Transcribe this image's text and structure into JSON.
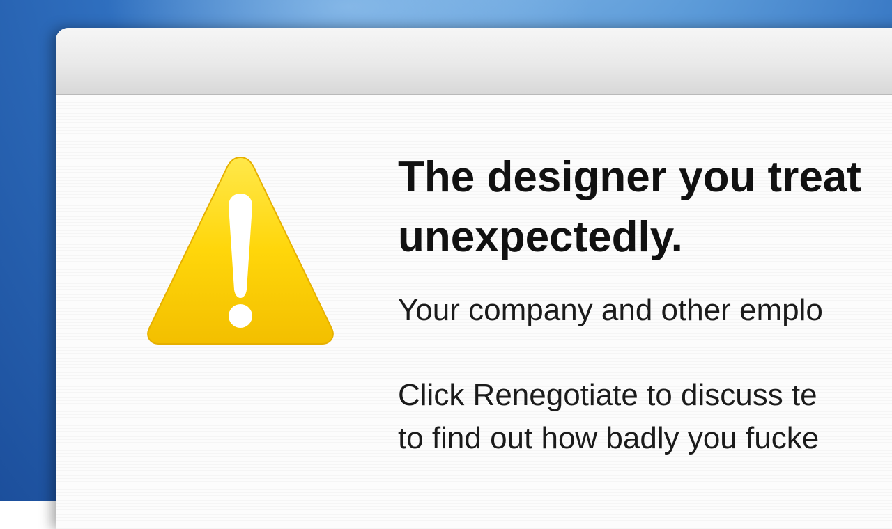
{
  "dialog": {
    "title_lines": "The designer you treat\nunexpectedly.",
    "message": "Your company and other emplo",
    "instruction_lines": "Click Renegotiate to discuss te\nto find out how badly you fucke"
  },
  "icons": {
    "warning": "warning-triangle-icon"
  },
  "colors": {
    "desktop_blue": "#2f6fbf",
    "warning_yellow": "#ffd400",
    "title_text": "#111111"
  }
}
